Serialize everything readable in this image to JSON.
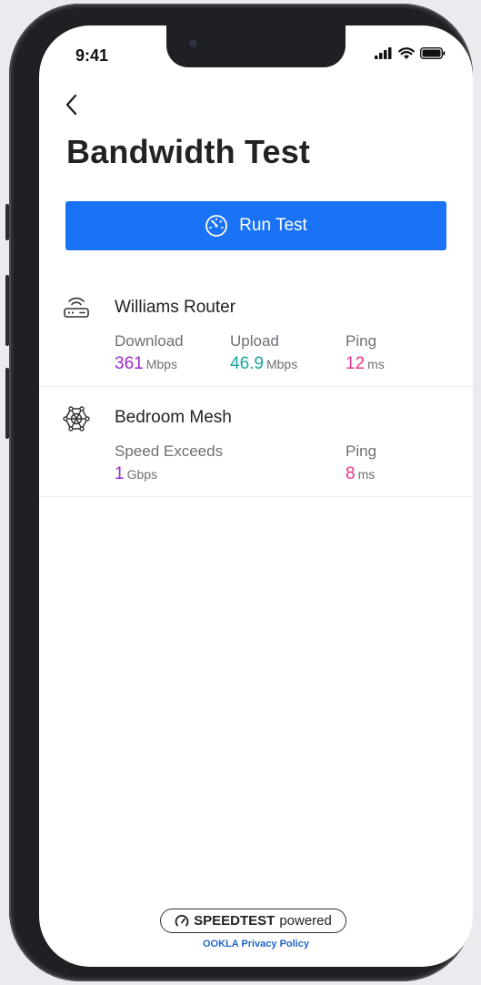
{
  "status": {
    "time": "9:41"
  },
  "page": {
    "title": "Bandwidth Test"
  },
  "run_button": {
    "label": "Run Test"
  },
  "devices": [
    {
      "name": "Williams Router",
      "metrics": [
        {
          "label": "Download",
          "value": "361",
          "unit": "Mbps"
        },
        {
          "label": "Upload",
          "value": "46.9",
          "unit": "Mbps"
        },
        {
          "label": "Ping",
          "value": "12",
          "unit": "ms"
        }
      ]
    },
    {
      "name": "Bedroom Mesh",
      "metrics": [
        {
          "label": "Speed Exceeds",
          "value": "1",
          "unit": "Gbps"
        },
        {
          "label": "Ping",
          "value": "8",
          "unit": "ms"
        }
      ]
    }
  ],
  "footer": {
    "badge_brand": "SPEEDTEST",
    "badge_suffix": "powered",
    "privacy_link": "OOKLA Privacy Policy"
  },
  "colors": {
    "accent": "#1a73f5",
    "download": "#9b27c8",
    "upload": "#1aa6a0",
    "ping": "#e8358c"
  },
  "icons": {
    "back": "chevron-left-icon",
    "run": "speedometer-icon",
    "router": "router-icon",
    "mesh": "mesh-node-icon"
  }
}
